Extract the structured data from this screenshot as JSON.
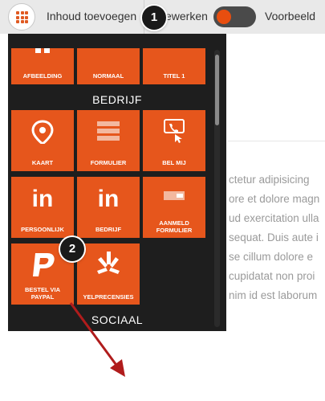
{
  "topbar": {
    "add_content_label": "Inhoud toevoegen",
    "edit_label": "ewerken",
    "preview_label": "Voorbeeld"
  },
  "callouts": {
    "one": "1",
    "two": "2"
  },
  "panel": {
    "top_row": [
      "AFBEELDING",
      "NORMAAL",
      "TITEL 1"
    ],
    "section_business": "BEDRIJF",
    "business_tiles": [
      {
        "label": "KAART",
        "icon": "map-pin-icon"
      },
      {
        "label": "FORMULIER",
        "icon": "form-icon"
      },
      {
        "label": "BEL MIJ",
        "icon": "call-me-icon"
      },
      {
        "label": "PERSOONLIJK",
        "icon": "linkedin-icon"
      },
      {
        "label": "BEDRIJF",
        "icon": "linkedin-icon"
      },
      {
        "label": "AANMELD FORMULIER",
        "icon": "signup-form-icon"
      },
      {
        "label": "BESTEL VIA PAYPAL",
        "icon": "paypal-icon"
      },
      {
        "label": "YELPRECENSIES",
        "icon": "yelp-icon"
      }
    ],
    "section_social": "SOCIAAL"
  },
  "background_text": [
    "ctetur adipisicing",
    "ore et dolore magn",
    "ud exercitation ulla",
    "sequat. Duis aute i",
    "se cillum dolore e",
    "cupidatat non proi",
    "nim id est laborum"
  ],
  "colors": {
    "accent": "#e6561c",
    "panel_bg": "#1e1e1e",
    "arrow": "#b01c1c"
  }
}
